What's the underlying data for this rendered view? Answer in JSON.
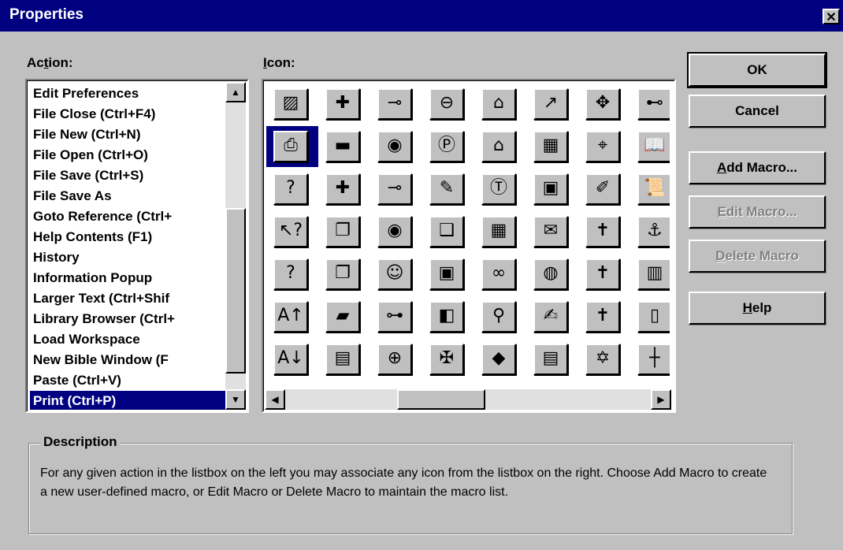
{
  "window": {
    "title": "Properties",
    "close_glyph": "✕"
  },
  "action": {
    "label_pre": "Ac",
    "label_ul": "t",
    "label_post": "ion:",
    "items": [
      "Edit Preferences",
      "File Close (Ctrl+F4)",
      "File New (Ctrl+N)",
      "File Open (Ctrl+O)",
      "File Save (Ctrl+S)",
      "File Save As",
      "Goto Reference (Ctrl+",
      "Help Contents (F1)",
      "History",
      "Information Popup",
      "Larger Text (Ctrl+Shif",
      "Library Browser (Ctrl+",
      "Load Workspace",
      "New Bible Window (F",
      "Paste (Ctrl+V)",
      "Print (Ctrl+P)"
    ],
    "selected_index": 15
  },
  "icon_list": {
    "label_ul": "I",
    "label_post": "con:",
    "selected": {
      "row": 1,
      "col": 0
    },
    "icons": [
      [
        "notepad-icon",
        "plus-icon",
        "pushpin-icon",
        "zoom-out-icon",
        "tombstone-s-icon",
        "green-arrow-icon",
        "move-icon",
        "ruler-icon"
      ],
      [
        "printer-icon",
        "minus-icon",
        "eraser-icon",
        "zoom-p-icon",
        "tombstone-p-icon",
        "map-icon",
        "dimension-icon",
        "open-book-icon"
      ],
      [
        "question-bubble-icon",
        "double-plus-icon",
        "pushpin-icon",
        "edit-page-icon",
        "column-icon",
        "yellow-page-icon",
        "pencil-icon",
        "scroll-icon"
      ],
      [
        "whats-this-icon",
        "stacked-pages-icon",
        "eraser-icon",
        "layers-icon",
        "grid-icon",
        "envelope-map-icon",
        "cross-icon",
        "anchor-icon"
      ],
      [
        "help-question-icon",
        "pages-cycle-icon",
        "smiley-icon",
        "frame-icon",
        "glasses-icon",
        "globe-icon",
        "white-cross-icon",
        "building-icon"
      ],
      [
        "larger-text-icon",
        "red-book-icon",
        "binoculars-icon",
        "map-scroll-icon",
        "search-icon",
        "hand-write-icon",
        "gray-cross-icon",
        "door-icon"
      ],
      [
        "smaller-text-icon",
        "bible-open-icon",
        "zoom-in-icon",
        "maltese-cross-icon",
        "blue-book-icon",
        "form-icon",
        "star-of-david-icon",
        "grave-icon"
      ]
    ],
    "glyphs": [
      [
        "▨",
        "✚",
        "⊸",
        "⊖",
        "⌂",
        "↗",
        "✥",
        "⊷"
      ],
      [
        "⎙",
        "▬",
        "◉",
        "Ⓟ",
        "⌂",
        "▦",
        "⌖",
        "📖"
      ],
      [
        "?",
        "✚",
        "⊸",
        "✎",
        "Ⓣ",
        "▣",
        "✐",
        "📜"
      ],
      [
        "↖?",
        "❐",
        "◉",
        "❑",
        "▦",
        "✉",
        "✝",
        "⚓"
      ],
      [
        "?",
        "❐",
        "☺",
        "▣",
        "∞",
        "◍",
        "✝",
        "▥"
      ],
      [
        "A↑",
        "▰",
        "⊶",
        "◧",
        "⚲",
        "✍",
        "✝",
        "▯"
      ],
      [
        "A↓",
        "▤",
        "⊕",
        "✠",
        "◆",
        "▤",
        "✡",
        "┼"
      ]
    ]
  },
  "buttons": {
    "ok": "OK",
    "cancel": "Cancel",
    "add_macro_ul": "A",
    "add_macro_rest": "dd Macro...",
    "edit_macro_ul": "E",
    "edit_macro_rest": "dit Macro...",
    "delete_macro_ul": "D",
    "delete_macro_rest": "elete Macro",
    "help_ul": "H",
    "help_rest": "elp"
  },
  "description": {
    "title": "Description",
    "text": "For any given action in the listbox on the left you may associate any icon from the listbox on the right. Choose Add Macro to create a new user-defined macro, or Edit Macro or Delete Macro to maintain the macro list."
  },
  "scroll": {
    "up": "▲",
    "down": "▼",
    "left": "◀",
    "right": "▶"
  }
}
